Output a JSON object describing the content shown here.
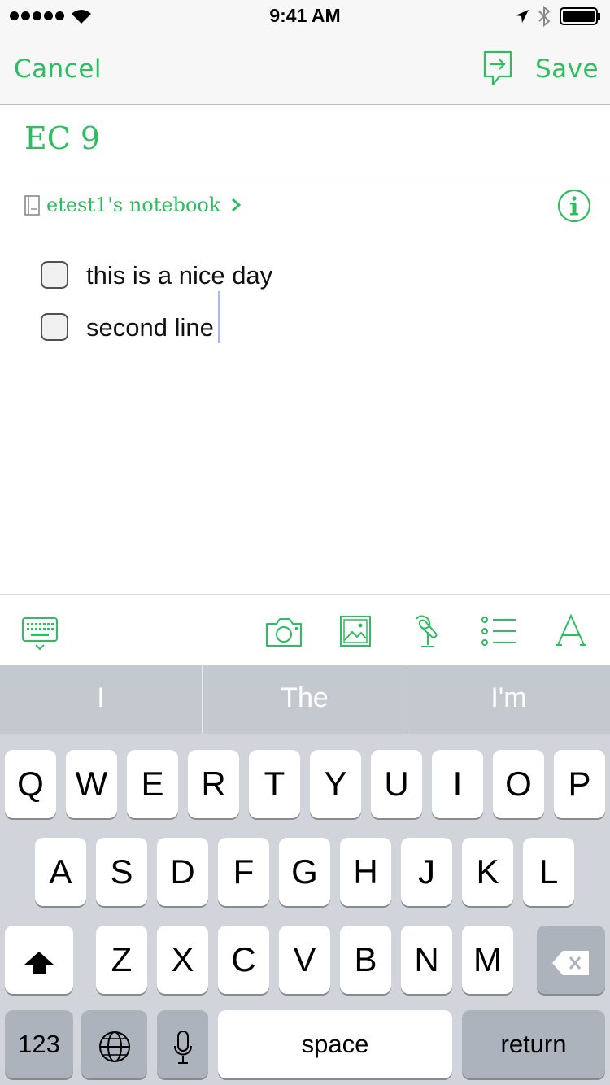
{
  "status_bar": {
    "time": "9:41 AM"
  },
  "nav": {
    "cancel_label": "Cancel",
    "save_label": "Save"
  },
  "note": {
    "title": "EC 9",
    "notebook": "etest1's notebook",
    "checklist": [
      {
        "text": "this is a nice day",
        "checked": false
      },
      {
        "text": "second line",
        "checked": false
      }
    ]
  },
  "suggestions": [
    "I",
    "The",
    "I'm"
  ],
  "keyboard": {
    "row1": [
      "Q",
      "W",
      "E",
      "R",
      "T",
      "Y",
      "U",
      "I",
      "O",
      "P"
    ],
    "row2": [
      "A",
      "S",
      "D",
      "F",
      "G",
      "H",
      "J",
      "K",
      "L"
    ],
    "row3": [
      "Z",
      "X",
      "C",
      "V",
      "B",
      "N",
      "M"
    ],
    "numbers_label": "123",
    "space_label": "space",
    "return_label": "return"
  },
  "colors": {
    "accent": "#2dbe60"
  }
}
